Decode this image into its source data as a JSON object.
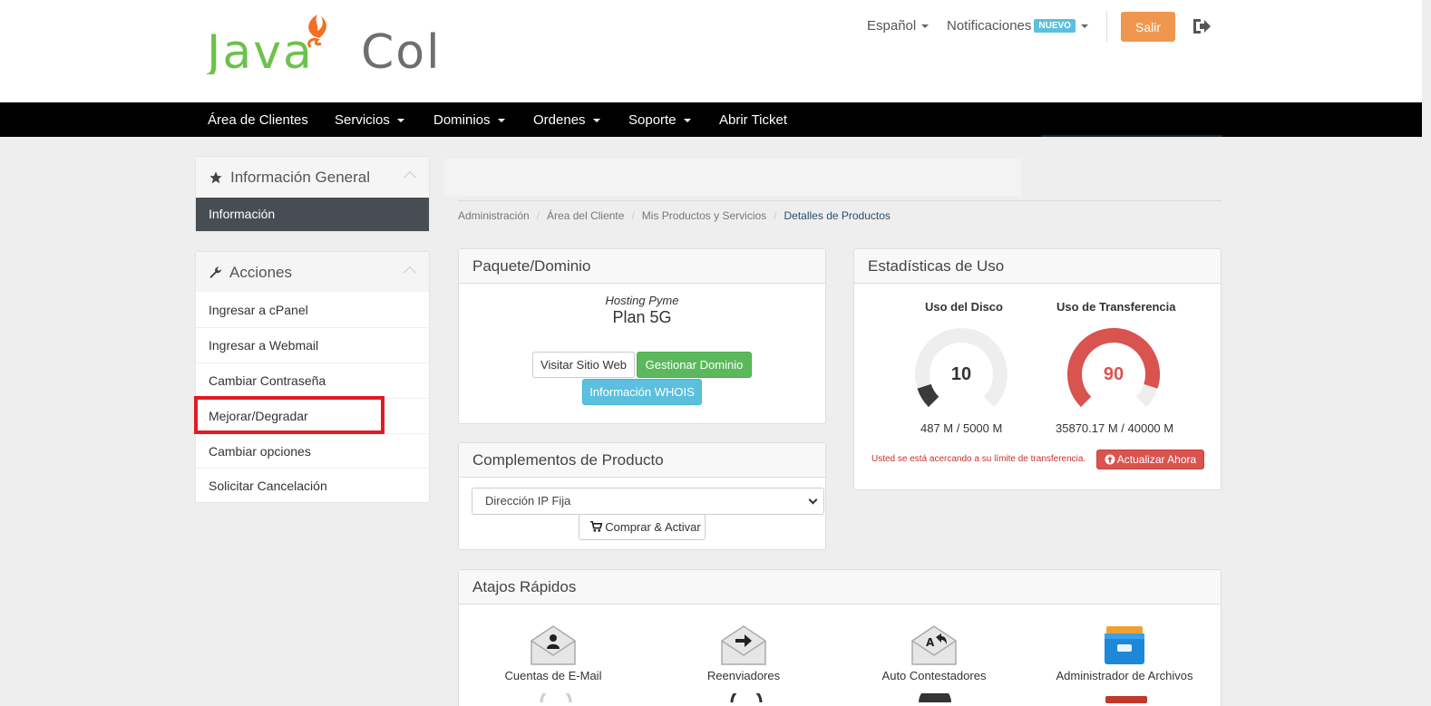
{
  "brand": {
    "logo_text_left": "Java",
    "logo_text_right": "Col",
    "green": "#6cc24a",
    "orange": "#f36f21",
    "gray": "#6d6e71"
  },
  "header": {
    "language": "Español",
    "notifications": "Notificaciones",
    "notifications_badge": "NUEVO",
    "logout_button": "Salir",
    "logout_icon": "sign-out-icon"
  },
  "nav": {
    "items": [
      {
        "label": "Área de Clientes",
        "dropdown": false
      },
      {
        "label": "Servicios",
        "dropdown": true
      },
      {
        "label": "Dominios",
        "dropdown": true
      },
      {
        "label": "Ordenes",
        "dropdown": true
      },
      {
        "label": "Soporte",
        "dropdown": true
      },
      {
        "label": "Abrir Ticket",
        "dropdown": false
      }
    ]
  },
  "sidebar": {
    "general": {
      "title": "Información General",
      "icon": "star-icon",
      "active_item": "Información"
    },
    "actions": {
      "title": "Acciones",
      "icon": "wrench-icon",
      "items": [
        "Ingresar a cPanel",
        "Ingresar a Webmail",
        "Cambiar Contraseña",
        "Mejorar/Degradar",
        "Cambiar opciones",
        "Solicitar Cancelación"
      ],
      "highlighted_item": "Mejorar/Degradar"
    }
  },
  "breadcrumb": [
    "Administración",
    "Área del Cliente",
    "Mis Productos y Servicios",
    "Detalles de Productos"
  ],
  "package": {
    "title": "Paquete/Dominio",
    "group": "Hosting Pyme",
    "plan": "Plan 5G",
    "buttons": {
      "visit": "Visitar Sitio Web",
      "manage": "Gestionar Dominio",
      "whois": "Información WHOIS"
    }
  },
  "addons": {
    "title": "Complementos de Producto",
    "selected_option": "Dirección IP Fija",
    "buy_button": "Comprar & Activar"
  },
  "stats": {
    "title": "Estadísticas de Uso",
    "disk": {
      "label": "Uso del Disco",
      "percent": 10,
      "detail": "487 M / 5000 M",
      "color": "#3a3a3a"
    },
    "transfer": {
      "label": "Uso de Transferencia",
      "percent": 90,
      "detail": "35870.17 M / 40000 M",
      "color": "#d9534f"
    },
    "warning": "Usted se está acercando a su límite de transferencia.",
    "upgrade_button": "Actualizar Ahora"
  },
  "shortcuts": {
    "title": "Atajos Rápidos",
    "items": [
      {
        "label": "Cuentas de E-Mail",
        "icon": "email-account-icon"
      },
      {
        "label": "Reenviadores",
        "icon": "email-forwarder-icon"
      },
      {
        "label": "Auto Contestadores",
        "icon": "autoresponder-icon"
      },
      {
        "label": "Administrador de Archivos",
        "icon": "file-manager-icon"
      }
    ]
  }
}
